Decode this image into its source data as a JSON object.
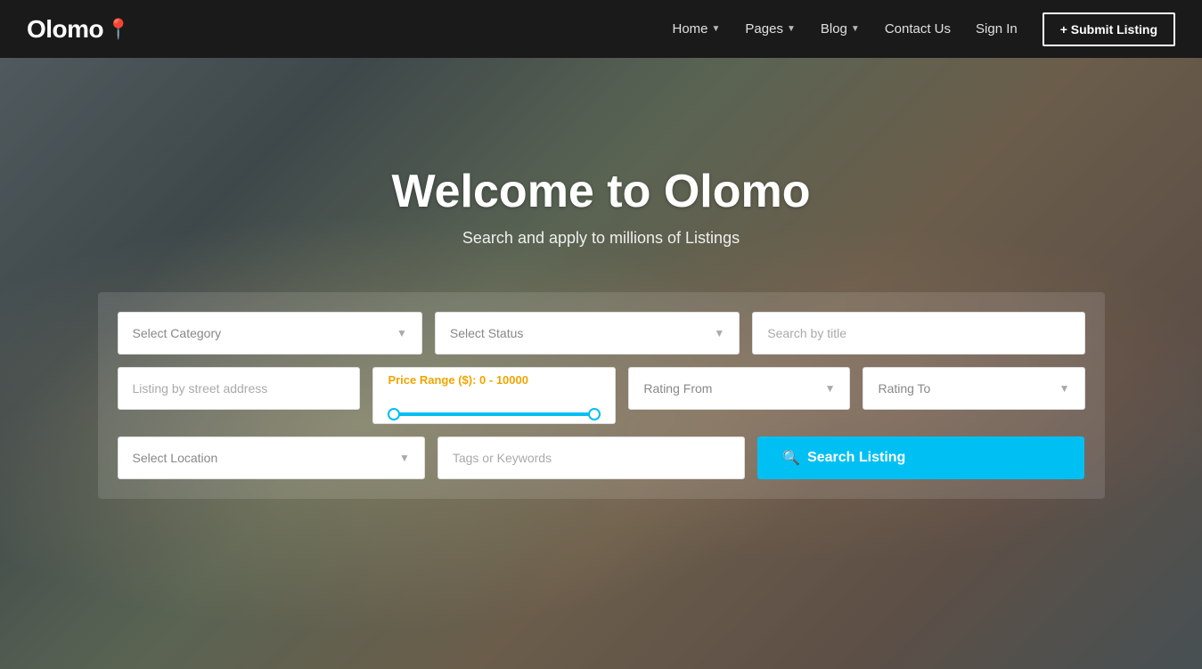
{
  "navbar": {
    "logo_text": "Olomo",
    "logo_pin": "📍",
    "nav_items": [
      {
        "label": "Home",
        "has_dropdown": true
      },
      {
        "label": "Pages",
        "has_dropdown": true
      },
      {
        "label": "Blog",
        "has_dropdown": true
      },
      {
        "label": "Contact Us",
        "has_dropdown": false
      },
      {
        "label": "Sign In",
        "has_dropdown": false
      }
    ],
    "submit_btn": "+ Submit Listing"
  },
  "hero": {
    "title": "Welcome to Olomo",
    "subtitle": "Search and apply to millions of Listings"
  },
  "search": {
    "select_category_placeholder": "Select Category",
    "select_status_placeholder": "Select Status",
    "search_title_placeholder": "Search by title",
    "street_address_placeholder": "Listing by street address",
    "price_range_label": "Price Range ($): 0 - 10000",
    "select_location_placeholder": "Select Location",
    "tags_placeholder": "Tags or Keywords",
    "rating_from_placeholder": "Rating From",
    "rating_to_placeholder": "Rating To",
    "search_btn_label": "Search Listing"
  },
  "icons": {
    "chevron": "▾",
    "search": "🔍",
    "pin": "📍",
    "plus": "+"
  }
}
